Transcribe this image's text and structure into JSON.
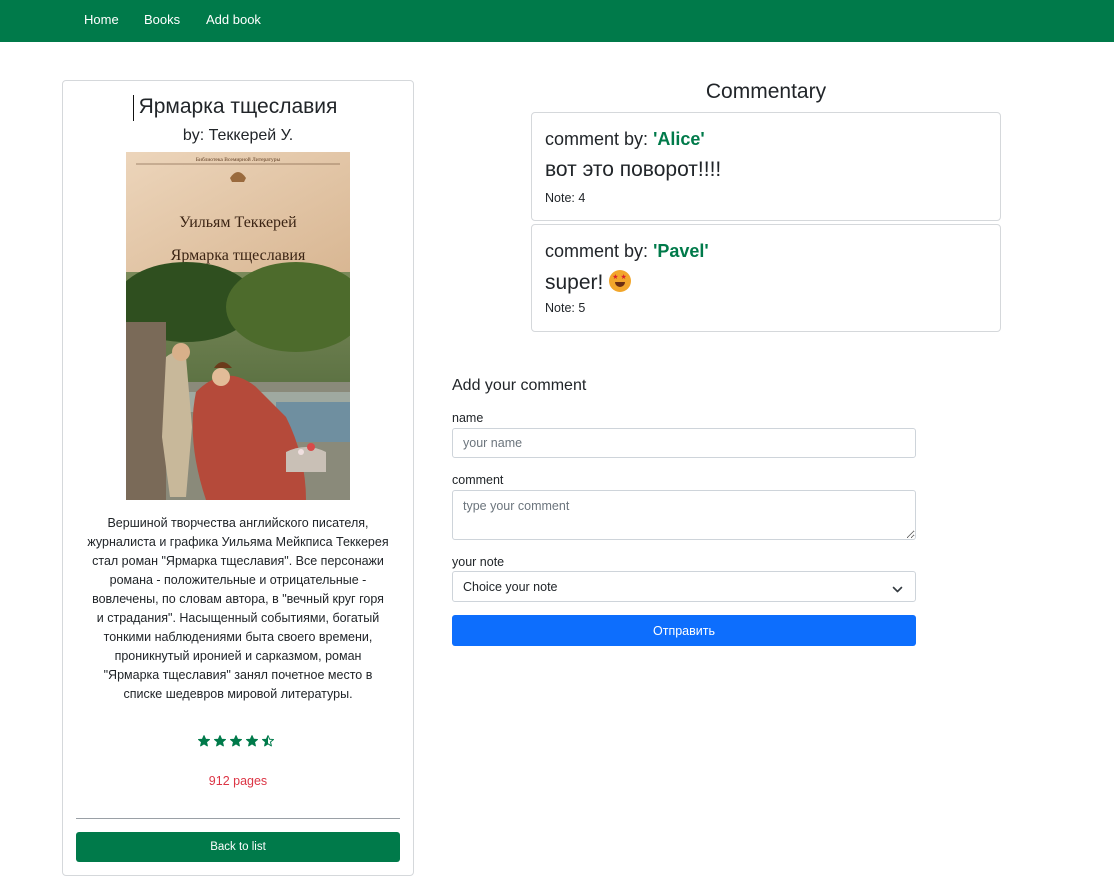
{
  "nav": {
    "home": "Home",
    "books": "Books",
    "add_book": "Add book"
  },
  "book": {
    "title": "Ярмарка тщеславия",
    "author": "by: Теккерей У.",
    "cover": {
      "series": "Библиотека Всемирной Литературы",
      "author": "Уильям Теккерей",
      "title": "Ярмарка тщеславия"
    },
    "description": "Вершиной творчества английского писателя, журналиста и графика Уильяма Мейкписа Теккерея стал роман \"Ярмарка тщеславия\". Все персонажи романа - положительные и отрицательные - вовлечены, по словам автора, в \"вечный круг горя и страдания\". Насыщенный событиями, богатый тонкими наблюдениями быта своего времени, проникнутый иронией и сарказмом, роман \"Ярмарка тщеславия\" занял почетное место в списке шедевров мировой литературы.",
    "rating": 4.5,
    "rating_max": 5,
    "pages": "912 pages",
    "back_label": "Back to list"
  },
  "commentary": {
    "title": "Commentary",
    "comments": [
      {
        "by_label": "comment by:",
        "name": "'Alice'",
        "text": "вот это поворот!!!!",
        "note": "Note: 4"
      },
      {
        "by_label": "comment by:",
        "name": "'Pavel'",
        "text": "super!",
        "emoji": "star-struck-emoji",
        "note": "Note: 5"
      }
    ]
  },
  "form": {
    "title": "Add your comment",
    "name_label": "name",
    "name_placeholder": "your name",
    "comment_label": "comment",
    "comment_placeholder": "type your comment",
    "note_label": "your note",
    "note_value": "Choice your note",
    "submit_label": "Отправить"
  },
  "colors": {
    "brand_green": "#007a4a",
    "primary_blue": "#0d6efd",
    "pages_red": "#dc3545"
  }
}
